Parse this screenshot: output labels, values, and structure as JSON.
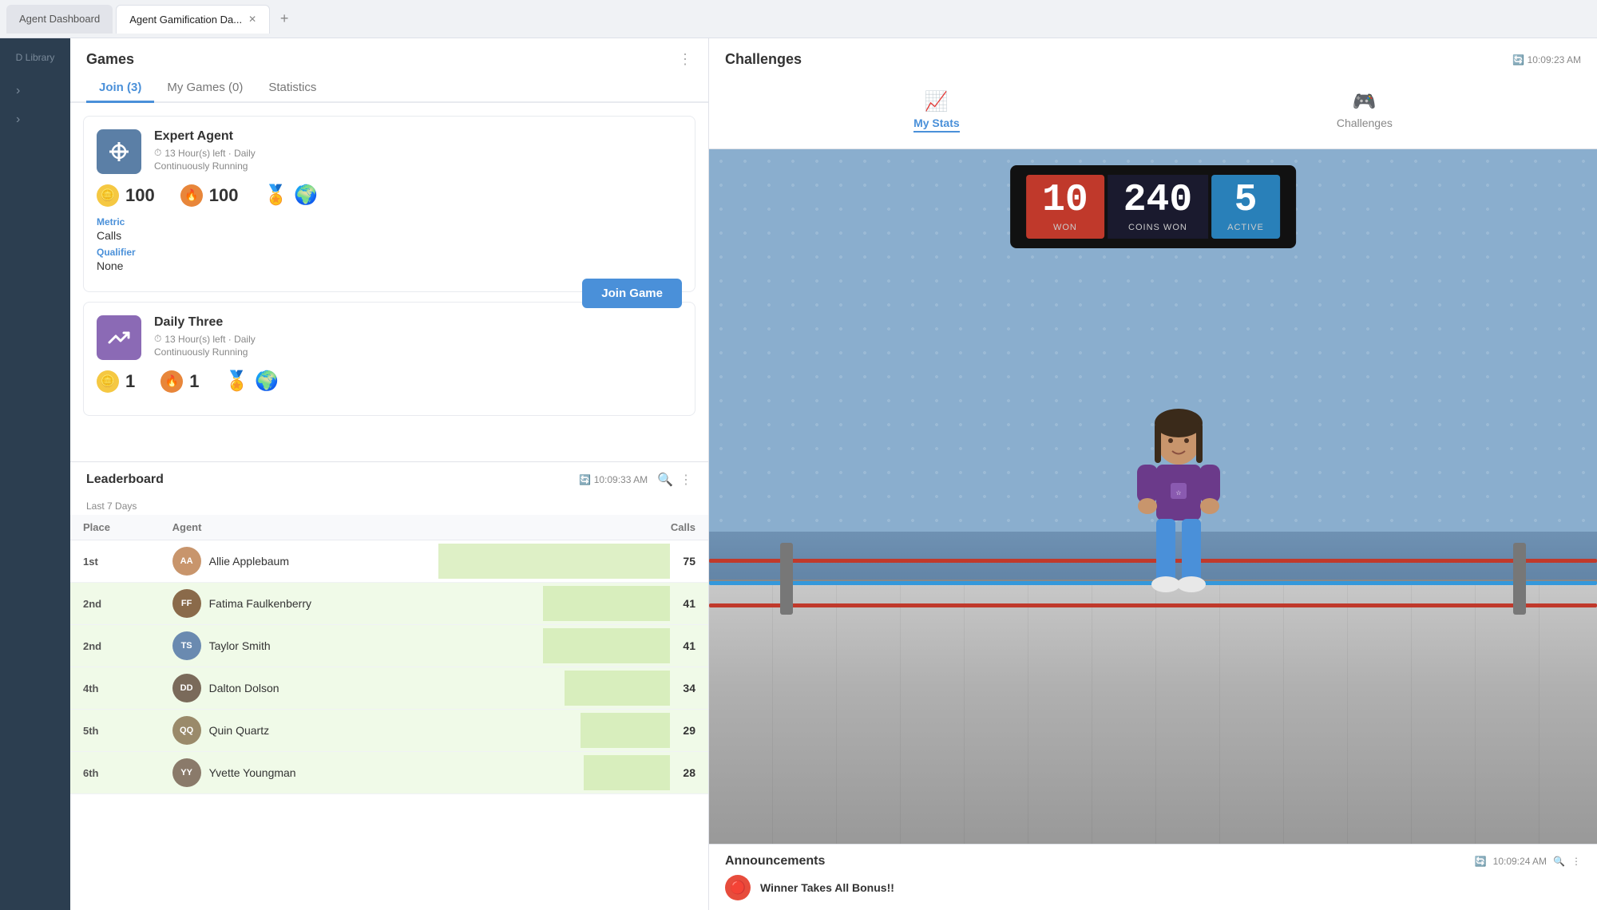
{
  "tabs": [
    {
      "id": "agent-dashboard",
      "label": "Agent Dashboard",
      "active": false
    },
    {
      "id": "gamification",
      "label": "Agent Gamification Da...",
      "active": true,
      "closable": true
    }
  ],
  "tab_add_icon": "+",
  "sidebar": {
    "items": [
      {
        "id": "library",
        "label": "D Library",
        "expandable": true
      },
      {
        "id": "expand1",
        "icon": "›"
      },
      {
        "id": "expand2",
        "icon": "›"
      }
    ]
  },
  "games": {
    "panel_title": "Games",
    "menu_icon": "⋮",
    "tabs": [
      {
        "id": "join",
        "label": "Join (3)",
        "active": true
      },
      {
        "id": "my-games",
        "label": "My Games (0)",
        "active": false
      },
      {
        "id": "statistics",
        "label": "Statistics",
        "active": false
      }
    ],
    "cards": [
      {
        "id": "expert-agent",
        "icon_type": "blue",
        "icon_symbol": "✕",
        "title": "Expert Agent",
        "time": "13 Hour(s) left · Daily",
        "running": "Continuously Running",
        "stats": [
          {
            "type": "gold",
            "icon": "😊",
            "value": "100"
          },
          {
            "type": "orange",
            "icon": "🔥",
            "value": "100"
          }
        ],
        "badges": [
          "🏅",
          "🌍"
        ],
        "metric_label": "Metric",
        "metric_value": "Calls",
        "qualifier_label": "Qualifier",
        "qualifier_value": "None",
        "join_button": "Join Game"
      },
      {
        "id": "daily-three",
        "icon_type": "purple",
        "icon_symbol": "📈",
        "title": "Daily Three",
        "time": "13 Hour(s) left · Daily",
        "running": "Continuously Running",
        "stats": [
          {
            "type": "gold",
            "icon": "😊",
            "value": "1"
          },
          {
            "type": "orange",
            "icon": "🔥",
            "value": "1"
          }
        ],
        "badges": [
          "🏅",
          "🌍"
        ]
      }
    ]
  },
  "leaderboard": {
    "title": "Leaderboard",
    "refresh_time": "10:09:33 AM",
    "period": "Last 7 Days",
    "columns": [
      "Place",
      "Agent",
      "Calls"
    ],
    "rows": [
      {
        "place": "1st",
        "agent": "Allie Applebaum",
        "calls": 75,
        "highlight": false
      },
      {
        "place": "2nd",
        "agent": "Fatima Faulkenberry",
        "calls": 41,
        "highlight": true
      },
      {
        "place": "2nd",
        "agent": "Taylor Smith",
        "calls": 41,
        "highlight": true
      },
      {
        "place": "4th",
        "agent": "Dalton Dolson",
        "calls": 34,
        "highlight": true
      },
      {
        "place": "5th",
        "agent": "Quin Quartz",
        "calls": 29,
        "highlight": true
      },
      {
        "place": "6th",
        "agent": "Yvette Youngman",
        "calls": 28,
        "highlight": true
      }
    ],
    "max_calls": 75
  },
  "challenges": {
    "title": "Challenges",
    "refresh_time": "10:09:23 AM",
    "tabs": [
      {
        "id": "my-stats",
        "label": "My Stats",
        "icon": "📈",
        "active": true
      },
      {
        "id": "challenges",
        "label": "Challenges",
        "icon": "🎮",
        "active": false
      }
    ],
    "scoreboard": {
      "won": {
        "value": "10",
        "label": "WON"
      },
      "coins_won": {
        "value": "240",
        "label": "COINS WON"
      },
      "active": {
        "value": "5",
        "label": "ACTIVE"
      }
    }
  },
  "announcements": {
    "title": "Announcements",
    "refresh_time": "10:09:24 AM",
    "items": [
      {
        "id": "winner-bonus",
        "text": "Winner Takes All Bonus!!",
        "icon": "🔴"
      }
    ]
  },
  "colors": {
    "primary_blue": "#4a90d9",
    "sidebar_bg": "#2c3e50",
    "card_border": "#e8eaef",
    "highlight_green": "#f0fae8",
    "red_score": "#c0392b",
    "blue_score": "#2980b9",
    "dark_score": "#1a1a2e"
  }
}
